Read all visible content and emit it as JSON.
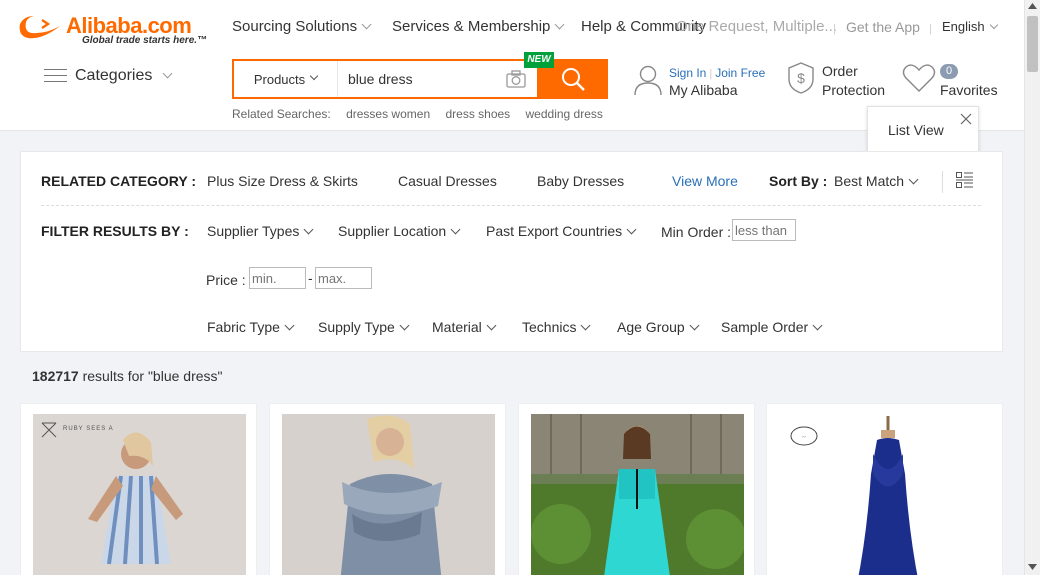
{
  "header": {
    "logo": {
      "wordmark": "Alibaba.com",
      "tagline": "Global trade starts here.™"
    },
    "nav": {
      "sourcing": "Sourcing Solutions",
      "services": "Services & Membership",
      "help": "Help & Community",
      "rfq_overlay": "One Request, Multiple...",
      "get_app": "Get the App",
      "language": "English"
    },
    "categories_label": "Categories",
    "search": {
      "category": "Products",
      "query": "blue dress",
      "new_badge": "NEW"
    },
    "related": {
      "label": "Related Searches:",
      "items": [
        "dresses women",
        "dress shoes",
        "wedding dress"
      ]
    },
    "account": {
      "sign_in": "Sign In",
      "join_free": "Join Free",
      "my_alibaba": "My Alibaba"
    },
    "order_protection": {
      "line1": "Order",
      "line2": "Protection"
    },
    "favorites": {
      "count": "0",
      "label": "Favorites"
    },
    "list_view_popup": "List View"
  },
  "filters": {
    "related_category_label": "RELATED CATEGORY :",
    "related_categories": [
      "Plus Size Dress & Skirts",
      "Casual Dresses",
      "Baby Dresses"
    ],
    "view_more": "View More",
    "sort_by_label": "Sort By :",
    "sort_by_value": "Best Match",
    "filter_label": "FILTER RESULTS BY :",
    "row1": [
      "Supplier Types",
      "Supplier Location",
      "Past Export Countries"
    ],
    "min_order_label": "Min Order :",
    "min_order_placeholder": "less than",
    "price_label": "Price :",
    "price_min_placeholder": "min.",
    "price_max_placeholder": "max.",
    "price_dash": "-",
    "row3": [
      "Fabric Type",
      "Supply Type",
      "Material",
      "Technics",
      "Age Group",
      "Sample Order"
    ]
  },
  "results": {
    "count": "182717",
    "text": "results for \"blue dress\""
  },
  "products": [
    {
      "watermark": "RUBY SEES A"
    },
    {},
    {},
    {}
  ],
  "colors": {
    "accent": "#ff6a00",
    "link": "#2a6fb8",
    "new_badge": "#00a13b"
  }
}
